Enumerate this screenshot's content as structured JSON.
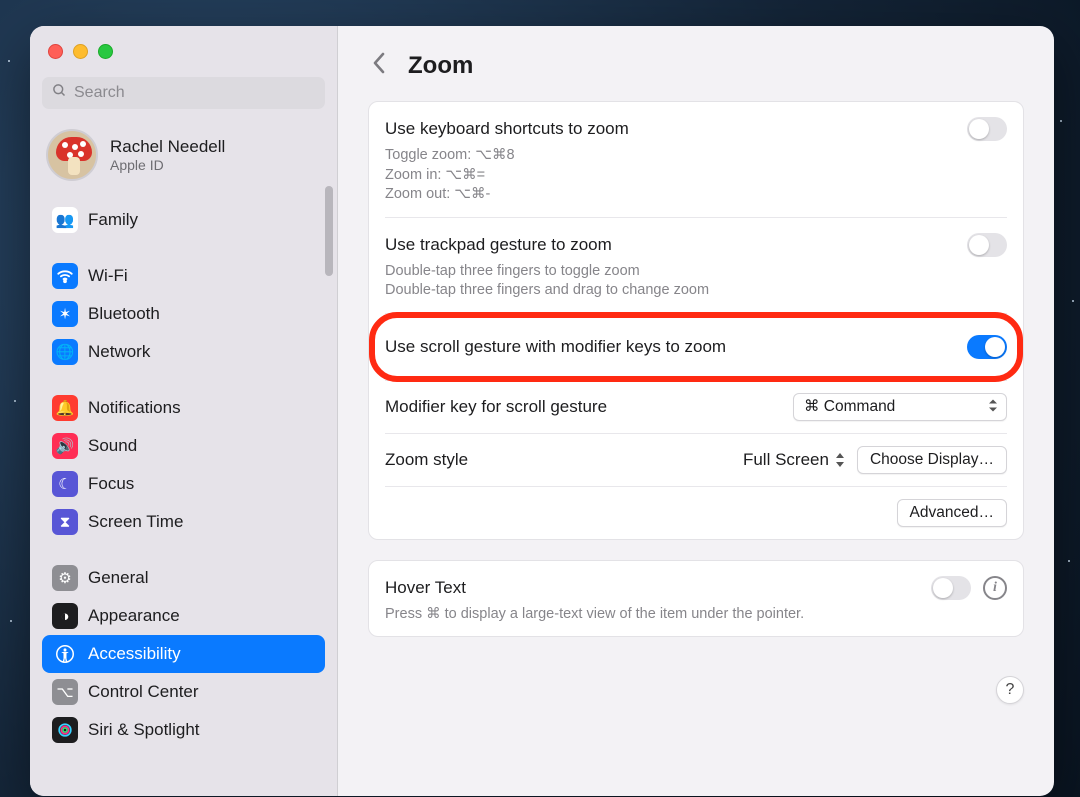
{
  "search": {
    "placeholder": "Search"
  },
  "account": {
    "name": "Rachel Needell",
    "sub": "Apple ID"
  },
  "sidebar": {
    "items": [
      {
        "label": "Family",
        "icon": "👥",
        "bg": "#ffffff",
        "fg": "#3b82f6"
      },
      {
        "label": "Wi-Fi",
        "icon": "wifi",
        "bg": "#0a7aff"
      },
      {
        "label": "Bluetooth",
        "icon": "✶",
        "bg": "#0a7aff"
      },
      {
        "label": "Network",
        "icon": "🌐",
        "bg": "#0a7aff"
      },
      {
        "label": "Notifications",
        "icon": "🔔",
        "bg": "#ff3b30"
      },
      {
        "label": "Sound",
        "icon": "🔊",
        "bg": "#ff2d55"
      },
      {
        "label": "Focus",
        "icon": "☾",
        "bg": "#5856d6"
      },
      {
        "label": "Screen Time",
        "icon": "⧗",
        "bg": "#5856d6"
      },
      {
        "label": "General",
        "icon": "⚙",
        "bg": "#8e8e93"
      },
      {
        "label": "Appearance",
        "icon": "◑",
        "bg": "#1d1d1f"
      },
      {
        "label": "Accessibility",
        "icon": "person",
        "bg": "#0a7aff",
        "selected": true
      },
      {
        "label": "Control Center",
        "icon": "⌥",
        "bg": "#8e8e93"
      },
      {
        "label": "Siri & Spotlight",
        "icon": "siri",
        "bg": "#1d1d1f"
      }
    ]
  },
  "header": {
    "title": "Zoom"
  },
  "main": {
    "rows": [
      {
        "title": "Use keyboard shortcuts to zoom",
        "sub": "Toggle zoom: ⌥⌘8\nZoom in: ⌥⌘=\nZoom out: ⌥⌘-",
        "toggle": false
      },
      {
        "title": "Use trackpad gesture to zoom",
        "sub": "Double-tap three fingers to toggle zoom\nDouble-tap three fingers and drag to change zoom",
        "toggle": false
      },
      {
        "title": "Use scroll gesture with modifier keys to zoom",
        "toggle": true,
        "highlight": true
      }
    ],
    "modifier": {
      "label": "Modifier key for scroll gesture",
      "value": "⌘ Command"
    },
    "zoomStyle": {
      "label": "Zoom style",
      "value": "Full Screen",
      "button": "Choose Display…"
    },
    "advanced": "Advanced…"
  },
  "hover": {
    "title": "Hover Text",
    "sub": "Press ⌘ to display a large-text view of the item under the pointer.",
    "toggle": false
  },
  "helpLabel": "?"
}
